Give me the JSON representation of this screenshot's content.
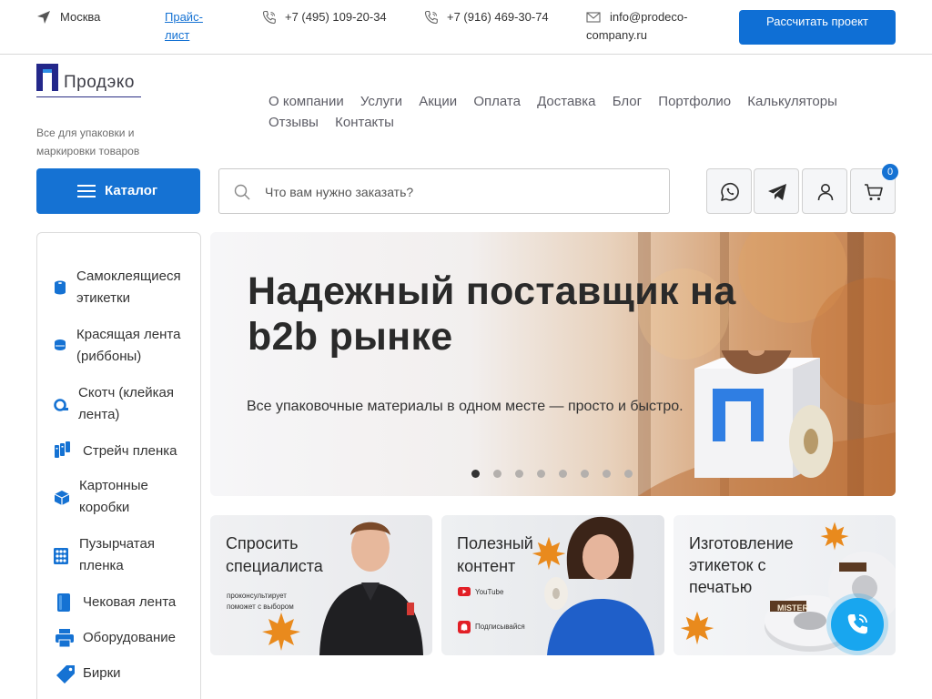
{
  "topbar": {
    "city": "Москва",
    "price_link": "Прайс-лист",
    "phone1": "+7 (495) 109-20-34",
    "phone2": "+7 (916) 469-30-74",
    "email": "info@prodeco-company.ru",
    "calc_button": "Рассчитать проект"
  },
  "header": {
    "logo_text": "Продэко",
    "tagline": "Все для упаковки и маркировки товаров",
    "nav": [
      "О компании",
      "Услуги",
      "Акции",
      "Оплата",
      "Доставка",
      "Блог",
      "Портфолио",
      "Калькуляторы",
      "Отзывы",
      "Контакты"
    ]
  },
  "search": {
    "catalog_button": "Каталог",
    "placeholder": "Что вам нужно заказать?",
    "cart_count": "0",
    "icons": [
      "whatsapp-icon",
      "telegram-icon",
      "user-icon",
      "cart-icon"
    ]
  },
  "sidebar": {
    "categories": [
      {
        "label": "Самоклеящиеся этикетки",
        "icon": "labels-roll-icon"
      },
      {
        "label": "Красящая лента (риббоны)",
        "icon": "ribbon-icon"
      },
      {
        "label": "Скотч (клейкая лента)",
        "icon": "tape-icon"
      },
      {
        "label": "Стрейч пленка",
        "icon": "stretch-film-icon"
      },
      {
        "label": "Картонные коробки",
        "icon": "box-icon"
      },
      {
        "label": "Пузырчатая пленка",
        "icon": "bubble-wrap-icon"
      },
      {
        "label": "Чековая лента",
        "icon": "receipt-roll-icon"
      },
      {
        "label": "Оборудование",
        "icon": "printer-icon"
      },
      {
        "label": "Бирки",
        "icon": "tag-icon"
      }
    ]
  },
  "hero": {
    "title": "Надежный поставщик на b2b рынке",
    "subtitle": "Все упаковочные материалы в одном месте — просто и быстро.",
    "slides_total": 8,
    "active_slide": 1
  },
  "banners": [
    {
      "title": "Спросить специалиста",
      "note": "проконсультирует поможет с выбором"
    },
    {
      "title": "Полезный контент",
      "links": [
        "YouTube",
        "Подписывайся"
      ]
    },
    {
      "title": "Изготовление этикеток с печатью",
      "product_label": "MISTER"
    }
  ],
  "colors": {
    "accent": "#1572d3",
    "fab": "#18a6ef"
  }
}
